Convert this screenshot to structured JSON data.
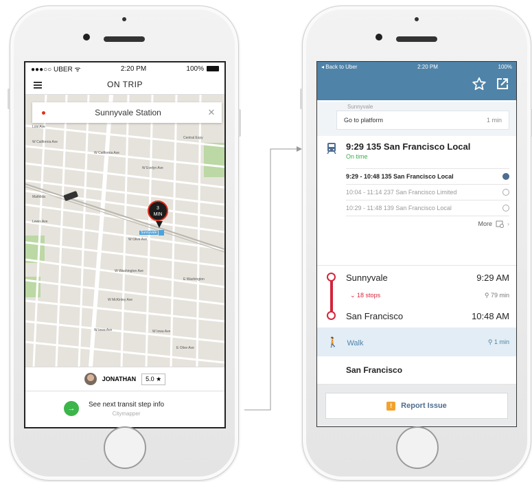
{
  "uber": {
    "status": {
      "carrier": "●●●○○ UBER ᯤ",
      "time": "2:20 PM",
      "battery": "100%"
    },
    "title": "ON TRIP",
    "destination": "Sunnyvale Station",
    "close_glyph": "✕",
    "eta": {
      "value": "3",
      "unit": "MIN"
    },
    "station_tag": "Sunnyvale",
    "driver": {
      "name": "JONATHAN",
      "rating": "5.0 ★"
    },
    "transit_prompt": "See next transit step info",
    "transit_source": "Citymapper"
  },
  "citymapper": {
    "status": {
      "back": "◂ Back to Uber",
      "time": "2:20 PM",
      "battery": "100%"
    },
    "faded_station": "Sunnyvale",
    "platform": {
      "label": "Go to platform",
      "time": "1 min"
    },
    "train": {
      "title": "9:29 135 San Francisco Local",
      "status": "On time"
    },
    "options": [
      {
        "label": "9:29 - 10:48 135 San Francisco Local",
        "selected": true
      },
      {
        "label": "10:04 - 11:14 237 San Francisco Limited",
        "selected": false
      },
      {
        "label": "10:29 - 11:48 139 San Francisco Local",
        "selected": false
      }
    ],
    "more_label": "More",
    "from": {
      "name": "Sunnyvale",
      "time": "9:29 AM"
    },
    "stops": "18 stops",
    "stops_duration": "79 min",
    "to": {
      "name": "San Francisco",
      "time": "10:48 AM"
    },
    "walk": {
      "label": "Walk",
      "time": "1 min"
    },
    "destination": "San Francisco",
    "report_label": "Report Issue"
  },
  "colors": {
    "cm_blue": "#4f83a8",
    "line_red": "#d4243a",
    "ontime_green": "#3cae49",
    "citymapper_green": "#3cb54a"
  }
}
